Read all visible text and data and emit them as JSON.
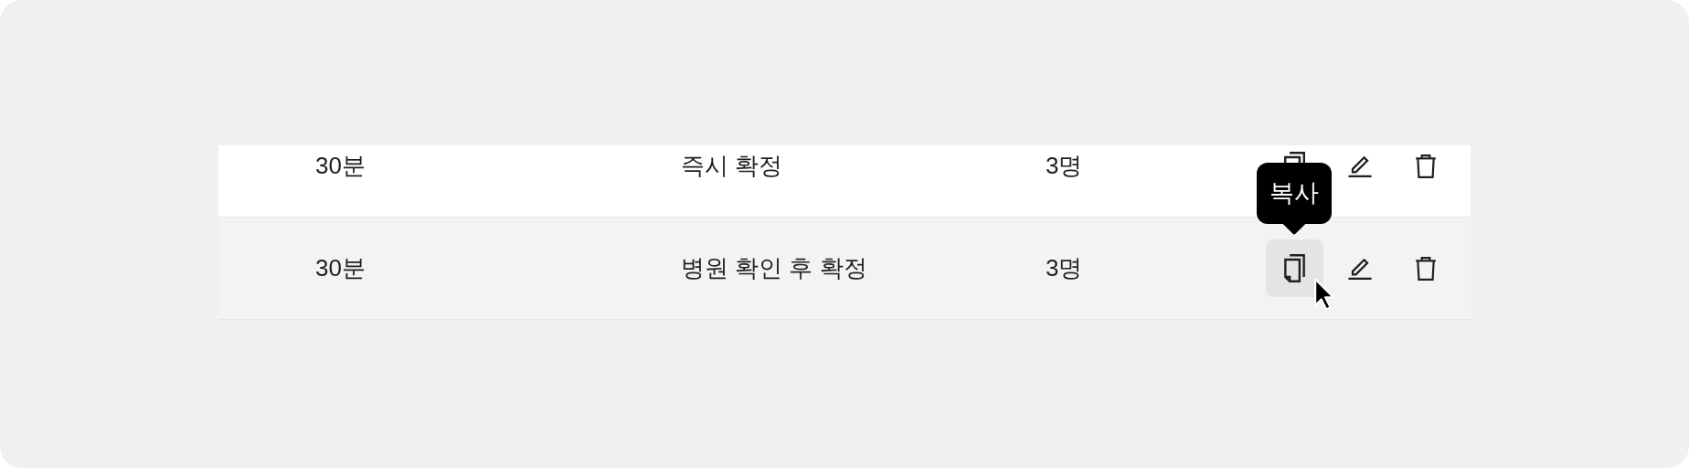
{
  "rows": [
    {
      "highlighted": false,
      "cells": [
        "30분",
        "즉시 확정",
        "3명"
      ],
      "actions": [
        {
          "kind": "copy",
          "hovered": false
        },
        {
          "kind": "edit",
          "hovered": false
        },
        {
          "kind": "delete",
          "hovered": false
        }
      ]
    },
    {
      "highlighted": true,
      "cells": [
        "30분",
        "병원 확인 후 확정",
        "3명"
      ],
      "actions": [
        {
          "kind": "copy",
          "hovered": true,
          "tooltip": "복사"
        },
        {
          "kind": "edit",
          "hovered": false
        },
        {
          "kind": "delete",
          "hovered": false
        }
      ]
    }
  ]
}
